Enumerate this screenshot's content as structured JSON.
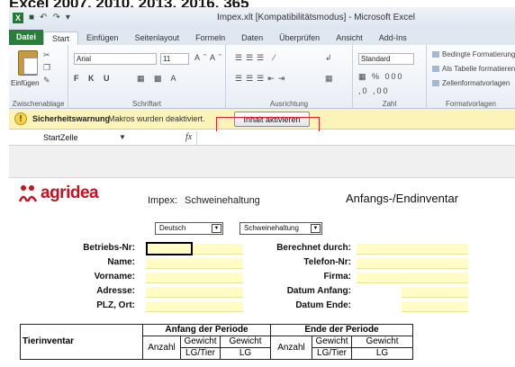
{
  "caption": "Excel 2007, 2010, 2013, 2016, 365",
  "window": {
    "title": "Impex.xlt [Kompatibilitätsmodus] - Microsoft Excel"
  },
  "ribbon": {
    "tabs": [
      "Datei",
      "Start",
      "Einfügen",
      "Seitenlayout",
      "Formeln",
      "Daten",
      "Überprüfen",
      "Ansicht",
      "Add-Ins"
    ],
    "active_tab": "Start",
    "paste_label": "Einfügen",
    "font_name": "Arial",
    "font_size": "11",
    "number_format": "Standard",
    "groups": [
      "Zwischenablage",
      "Schriftart",
      "Ausrichtung",
      "Zahl",
      "Formatvorlagen"
    ],
    "styles": [
      "Bedingte Formatierung",
      "Als Tabelle formatieren",
      "Zellenformatvorlagen"
    ]
  },
  "security": {
    "title": "Sicherheitswarnung",
    "message": "Makros wurden deaktiviert.",
    "button": "Inhalt aktivieren",
    "highlight_color": "#e0202a"
  },
  "formula_bar": {
    "name_box": "StartZelle",
    "fx": "fx",
    "value": ""
  },
  "sheet": {
    "logo": "agridea",
    "impex": "Impex:",
    "impex_sub": "Schweinehaltung",
    "right_title": "Anfangs-/Endinventar",
    "language": "Deutsch",
    "category": "Schweinehaltung",
    "left_labels": [
      "Betriebs-Nr:",
      "Name:",
      "Vorname:",
      "Adresse:",
      "PLZ, Ort:"
    ],
    "right_labels": [
      "Berechnet durch:",
      "Telefon-Nr:",
      "Firma:",
      "Datum Anfang:",
      "Datum Ende:"
    ],
    "field_color": "#fffcc4"
  },
  "table": {
    "row_label": "Tierinventar",
    "period_start": "Anfang der Periode",
    "period_end": "Ende der Periode",
    "col_count": "Anzahl",
    "col_weight": "Gewicht",
    "unit_animal": "LG/Tier",
    "unit_total": "LG"
  },
  "icons": [
    "warning-icon",
    "dropdown-arrow-icon",
    "fx-icon",
    "paste-icon",
    "excel-icon",
    "save-icon",
    "undo-icon",
    "redo-icon"
  ]
}
